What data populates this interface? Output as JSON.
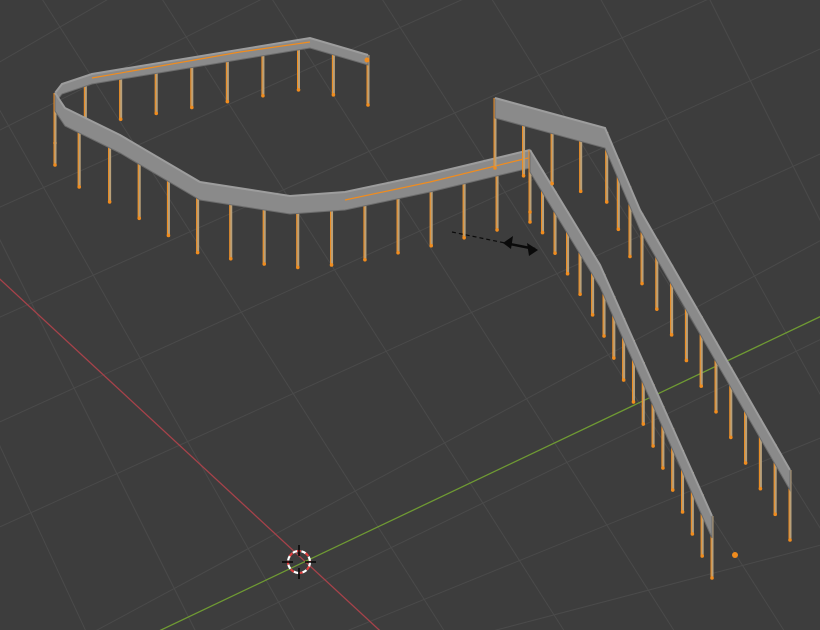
{
  "viewport": {
    "colors": {
      "background": "#3d3d3d",
      "grid": "#4a4a4a",
      "x_axis": "#a6424a",
      "y_axis": "#6f9a33",
      "rail": "#8a8a8a",
      "rail_top": "#9d9d9d",
      "rail_edge": "#6c6c6c",
      "post": "#b8a07a",
      "selection": "#f08c1e",
      "cursor_red": "#e04040",
      "cursor_white": "#ffffff",
      "arrow": "#0a0a0a"
    },
    "objects": [
      {
        "name": "railing-curved",
        "selected": true
      },
      {
        "name": "railing-straight-left",
        "selected": true
      },
      {
        "name": "railing-straight-right",
        "selected": true
      }
    ],
    "icons": [
      "3d-cursor-icon",
      "move-arrows-icon",
      "origin-dot-icon"
    ]
  }
}
